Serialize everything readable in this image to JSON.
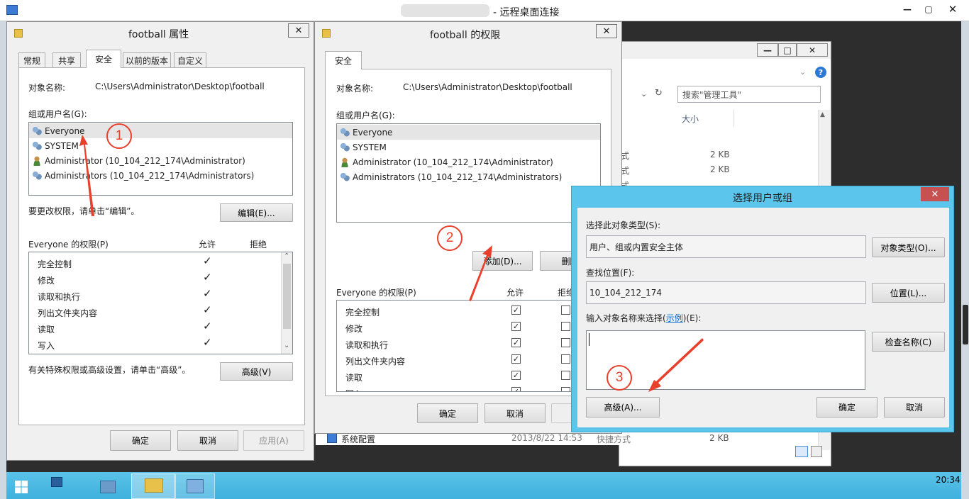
{
  "rdp": {
    "title": "- 远程桌面连接"
  },
  "props": {
    "title": "football 属性",
    "tabs": [
      "常规",
      "共享",
      "安全",
      "以前的版本",
      "自定义"
    ],
    "object_label": "对象名称:",
    "object_value": "C:\\Users\\Administrator\\Desktop\\football",
    "group_label": "组或用户名(G):",
    "users": [
      "Everyone",
      "SYSTEM",
      "Administrator (10_104_212_174\\Administrator)",
      "Administrators (10_104_212_174\\Administrators)"
    ],
    "change_hint": "要更改权限，请单击“编辑”。",
    "edit_btn": "编辑(E)...",
    "perm_label": "Everyone 的权限(P)",
    "allow": "允许",
    "deny": "拒绝",
    "perms": [
      "完全控制",
      "修改",
      "读取和执行",
      "列出文件夹内容",
      "读取",
      "写入"
    ],
    "adv_hint": "有关特殊权限或高级设置，请单击“高级”。",
    "adv_btn": "高级(V)",
    "ok": "确定",
    "cancel": "取消",
    "apply": "应用(A)"
  },
  "perm_dialog": {
    "title": "football 的权限",
    "tab": "安全",
    "object_label": "对象名称:",
    "object_value": "C:\\Users\\Administrator\\Desktop\\football",
    "group_label": "组或用户名(G):",
    "users": [
      "Everyone",
      "SYSTEM",
      "Administrator (10_104_212_174\\Administrator)",
      "Administrators (10_104_212_174\\Administrators)"
    ],
    "add_btn": "添加(D)...",
    "remove_btn": "删除",
    "perm_label": "Everyone 的权限(P)",
    "allow": "允许",
    "deny": "拒绝",
    "perms": [
      "完全控制",
      "修改",
      "读取和执行",
      "列出文件夹内容",
      "读取",
      "写入"
    ],
    "ok": "确定",
    "cancel": "取消",
    "apply": "应"
  },
  "explorer": {
    "search_placeholder": "搜索\"管理工具\"",
    "col_size": "大小",
    "rows": [
      {
        "type": "式",
        "size": "2 KB"
      },
      {
        "type": "式",
        "size": "2 KB"
      },
      {
        "type": "式",
        "size": ""
      }
    ],
    "bottom_name": "系统配置",
    "bottom_date": "2013/8/22 14:53",
    "bottom_type": "快捷方式",
    "bottom_size": "2 KB"
  },
  "select_dialog": {
    "title": "选择用户或组",
    "type_label": "选择此对象类型(S):",
    "type_value": "用户、组或内置安全主体",
    "type_btn": "对象类型(O)...",
    "loc_label": "查找位置(F):",
    "loc_value": "10_104_212_174",
    "loc_btn": "位置(L)...",
    "enter_label_pre": "输入对象名称来选择(",
    "enter_link": "示例",
    "enter_label_post": ")(E):",
    "check_btn": "检查名称(C)",
    "adv_btn": "高级(A)...",
    "ok": "确定",
    "cancel": "取消"
  },
  "annotations": [
    "1",
    "2",
    "3"
  ],
  "taskbar": {
    "time": "20:34"
  },
  "colors": {
    "accent": "#5bc5ec",
    "annot": "#e8402c",
    "link": "#0066cc"
  }
}
